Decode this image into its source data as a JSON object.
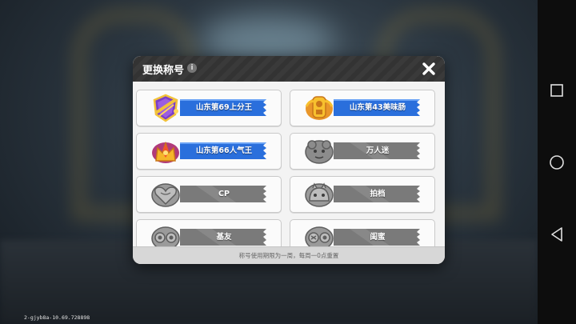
{
  "dialog": {
    "title": "更换称号",
    "info_icon": "info-icon",
    "close_icon": "close-icon",
    "footer_note": "称号使用期限为一周，每周一0点重置"
  },
  "titles": [
    {
      "label": "山东第69上分王",
      "active": true,
      "badge": "purple-crest-badge",
      "accent": "#2a6fdc"
    },
    {
      "label": "山东第43美味肠",
      "active": true,
      "badge": "gold-shield-badge",
      "accent": "#2a6fdc"
    },
    {
      "label": "山东第66人气王",
      "active": true,
      "badge": "fire-crown-badge",
      "accent": "#2a6fdc"
    },
    {
      "label": "万人迷",
      "active": false,
      "badge": "mascot-badge",
      "accent": "#7a7a7a"
    },
    {
      "label": "CP",
      "active": false,
      "badge": "heart-badge",
      "accent": "#7a7a7a"
    },
    {
      "label": "拍档",
      "active": false,
      "badge": "partner-badge",
      "accent": "#7a7a7a"
    },
    {
      "label": "基友",
      "active": false,
      "badge": "buddy-badge",
      "accent": "#7a7a7a"
    },
    {
      "label": "闺蜜",
      "active": false,
      "badge": "bestie-badge",
      "accent": "#7a7a7a"
    }
  ],
  "build_id": "2-gjyb8a-10.69.728898",
  "system_nav": {
    "recents": "square-icon",
    "home": "circle-icon",
    "back": "triangle-back-icon"
  }
}
